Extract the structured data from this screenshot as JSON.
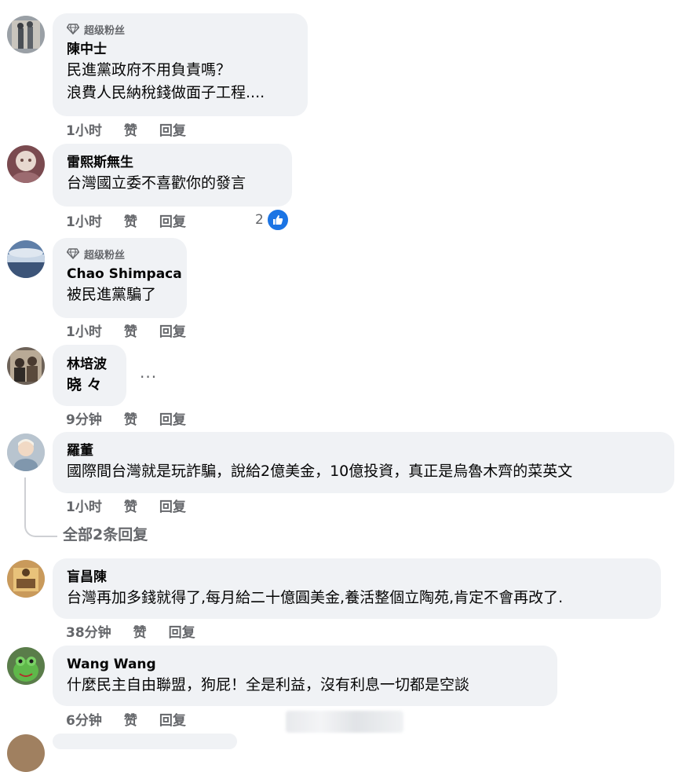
{
  "comments": [
    {
      "badge": "超级粉丝",
      "author": "陳中士",
      "lines": [
        "民進黨政府不用負責嗎？",
        "浪費人民納稅錢做面子工程...."
      ],
      "time": "1小时",
      "like": "赞",
      "reply": "回复"
    },
    {
      "author": "雷熙斯無生",
      "lines": [
        "台灣國立委不喜歡你的發言"
      ],
      "time": "1小时",
      "like": "赞",
      "reply": "回复",
      "reaction_count": "2"
    },
    {
      "badge": "超级粉丝",
      "author": "Chao Shimpaca",
      "lines": [
        "被民進黨騙了"
      ],
      "time": "1小时",
      "like": "赞",
      "reply": "回复"
    },
    {
      "author": "林培波",
      "lines": [
        "晓 々"
      ],
      "more": "···",
      "time": "9分钟",
      "like": "赞",
      "reply": "回复"
    },
    {
      "author": "羅董",
      "lines": [
        "國際間台灣就是玩詐騙，說給2億美金，10億投資，真正是烏魯木齊的菜英文"
      ],
      "time": "1小时",
      "like": "赞",
      "reply": "回复",
      "view_replies": "全部2条回复"
    },
    {
      "author": "盲昌陳",
      "lines": [
        "台灣再加多錢就得了,每月給二十億圓美金,養活整個立陶苑,肯定不會再改了."
      ],
      "time": "38分钟",
      "like": "赞",
      "reply": "回复"
    },
    {
      "author": "Wang Wang",
      "lines": [
        "什麼民主自由聯盟，狗屁！全是利益，沒有利息一切都是空談"
      ],
      "time": "6分钟",
      "like": "赞",
      "reply": "回复"
    }
  ],
  "colors": {
    "bubble": "#f0f2f5",
    "meta_text": "#65676b",
    "like_blue": "#1b74e4"
  },
  "icons": {
    "badge": "diamond-icon",
    "reaction": "thumbs-up-icon"
  }
}
